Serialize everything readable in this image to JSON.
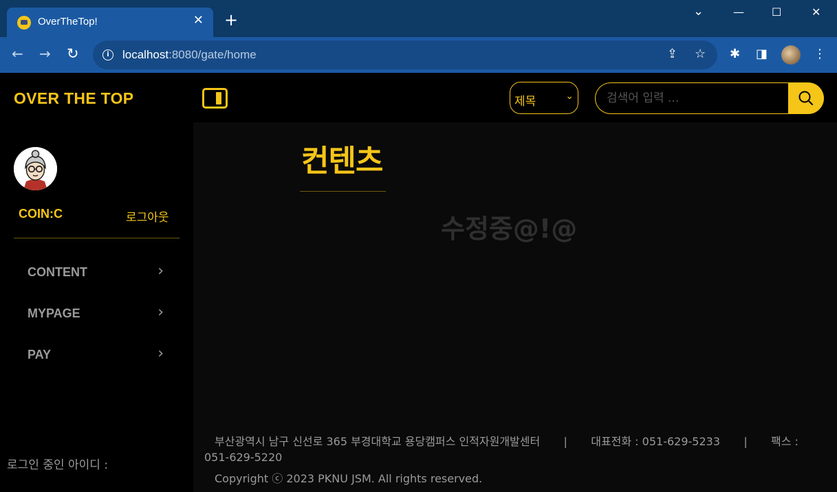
{
  "browser": {
    "tab_title": "OverTheTop!",
    "tab_close": "✕",
    "new_tab": "+",
    "url_host": "localhost",
    "url_rest": ":8080/gate/home",
    "minimize": "—",
    "maximize": "☐",
    "close": "✕",
    "chevron_down": "⌄",
    "back": "←",
    "forward": "→",
    "reload": "↻",
    "share": "⇪",
    "star": "☆",
    "extensions": "✱",
    "sidepanel": "◨",
    "menu": "⋮"
  },
  "sidebar": {
    "brand": "OVER THE TOP",
    "coin_label": "COIN:C",
    "logout": "로그아웃",
    "menu": [
      {
        "label": "CONTENT",
        "chevron": "›"
      },
      {
        "label": "MYPAGE",
        "chevron": "›"
      },
      {
        "label": "PAY",
        "chevron": "›"
      }
    ],
    "login_id_label": "로그인 중인 아이디 :"
  },
  "header": {
    "search_type": "제목",
    "search_type_arrow": "⌄",
    "search_placeholder": "검색어 입력 ..."
  },
  "main": {
    "title": "컨텐츠",
    "message": "수정중@!@"
  },
  "footer": {
    "address": "부산광역시 남구 신선로 365 부경대학교 용당캠퍼스 인적자원개발센터",
    "separator": "|",
    "phone": "대표전화 : 051-629-5233",
    "fax_label": "팩스 :",
    "fax_number": "051-629-5220",
    "copyright": "Copyright ⓒ 2023 PKNU JSM. All rights reserved."
  },
  "colors": {
    "accent": "#f5c518",
    "chrome_tab": "#1b5aa3",
    "chrome_strip": "#0e3a66",
    "muted_text": "#9a9a9a"
  }
}
